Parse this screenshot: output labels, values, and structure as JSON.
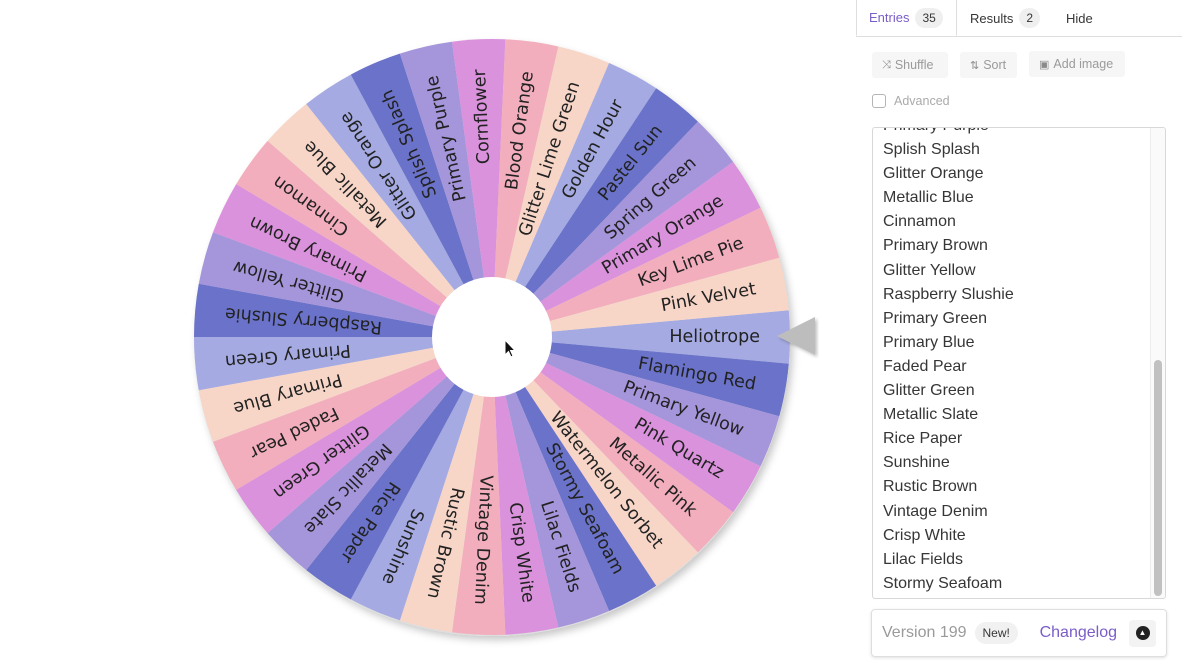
{
  "wheel": {
    "entries_clockwise_from_pointer": [
      "Heliotrope",
      "Flamingo Red",
      "Primary Yellow",
      "Pink Quartz",
      "Metallic Pink",
      "Watermelon Sorbet",
      "Stormy Seafoam",
      "Lilac Fields",
      "Crisp White",
      "Vintage Denim",
      "Rustic Brown",
      "Sunshine",
      "Rice Paper",
      "Metallic Slate",
      "Glitter Green",
      "Faded Pear",
      "Primary Blue",
      "Primary Green",
      "Raspberry Slushie",
      "Glitter Yellow",
      "Primary Brown",
      "Cinnamon",
      "Metallic Blue",
      "Glitter Orange",
      "Splish Splash",
      "Primary Purple",
      "Cornflower",
      "Blood Orange",
      "Glitter Lime Green",
      "Golden Hour",
      "Pastel Sun",
      "Spring Green",
      "Primary Orange",
      "Key Lime Pie",
      "Pink Velvet"
    ],
    "segment_colors_clockwise": [
      "#a5abe2",
      "#6a72c9",
      "#a595db",
      "#da92dc",
      "#f3aebd",
      "#f7d6c8",
      "#6a72c9",
      "#a595db",
      "#da92dc",
      "#f3aebd",
      "#f7d6c8",
      "#a5abe2",
      "#6a72c9",
      "#a595db",
      "#da92dc",
      "#f3aebd",
      "#f7d6c8",
      "#a5abe2",
      "#6a72c9",
      "#a595db",
      "#da92dc",
      "#f3aebd",
      "#f7d6c8",
      "#a5abe2",
      "#6a72c9",
      "#a595db",
      "#da92dc",
      "#f3aebd",
      "#f7d6c8",
      "#a5abe2",
      "#6a72c9",
      "#a595db",
      "#da92dc",
      "#f3aebd",
      "#f7d6c8"
    ],
    "pointer_color": "#bdbdbd"
  },
  "tabs": [
    {
      "label": "Entries",
      "badge": "35"
    },
    {
      "label": "Results",
      "badge": "2"
    },
    {
      "label": "Hide"
    }
  ],
  "toolbar": {
    "shuffle_label": "Shuffle",
    "sort_label": "Sort",
    "add_image_label": "Add image",
    "advanced_label": "Advanced",
    "advanced_checked": false
  },
  "entries_list": [
    "Primary Purple",
    "Splish Splash",
    "Glitter Orange",
    "Metallic Blue",
    "Cinnamon",
    "Primary Brown",
    "Glitter Yellow",
    "Raspberry Slushie",
    "Primary Green",
    "Primary Blue",
    "Faded Pear",
    "Glitter Green",
    "Metallic Slate",
    "Rice Paper",
    "Sunshine",
    "Rustic Brown",
    "Vintage Denim",
    "Crisp White",
    "Lilac Fields",
    "Stormy Seafoam"
  ],
  "footer": {
    "version_label": "Version 199",
    "new_badge": "New!",
    "changelog_label": "Changelog"
  },
  "colors": {
    "accent": "#7a5dc7"
  }
}
